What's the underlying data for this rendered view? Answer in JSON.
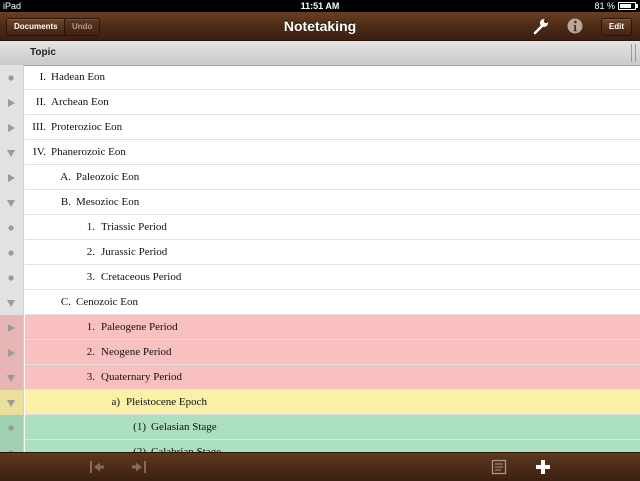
{
  "status_bar": {
    "device": "iPad",
    "time": "11:51 AM",
    "battery": "81 %",
    "battery_level": 0.81
  },
  "navbar": {
    "title": "Notetaking",
    "documents_label": "Documents",
    "undo_label": "Undo",
    "edit_label": "Edit",
    "icons": [
      "wrench-icon",
      "info-icon"
    ]
  },
  "column_header": {
    "label": "Topic"
  },
  "colors": {
    "navbar": "#4a2a15",
    "red_row": "#f9c0c0",
    "yellow_row": "#fbf0a8",
    "green_row": "#acdfbf"
  },
  "outline": [
    {
      "num": "I.",
      "text": "Hadean Eon",
      "level": 0,
      "state": "leaf",
      "color": "none"
    },
    {
      "num": "II.",
      "text": "Archean Eon",
      "level": 0,
      "state": "collapsed",
      "color": "none"
    },
    {
      "num": "III.",
      "text": "Proterozioc Eon",
      "level": 0,
      "state": "collapsed",
      "color": "none"
    },
    {
      "num": "IV.",
      "text": "Phanerozoic Eon",
      "level": 0,
      "state": "expanded",
      "color": "none"
    },
    {
      "num": "A.",
      "text": "Paleozoic Eon",
      "level": 1,
      "state": "collapsed",
      "color": "none"
    },
    {
      "num": "B.",
      "text": "Mesozioc Eon",
      "level": 1,
      "state": "expanded",
      "color": "none"
    },
    {
      "num": "1.",
      "text": "Triassic Period",
      "level": 2,
      "state": "leaf",
      "color": "none"
    },
    {
      "num": "2.",
      "text": "Jurassic Period",
      "level": 2,
      "state": "leaf",
      "color": "none"
    },
    {
      "num": "3.",
      "text": "Cretaceous Period",
      "level": 2,
      "state": "leaf",
      "color": "none"
    },
    {
      "num": "C.",
      "text": "Cenozoic Eon",
      "level": 1,
      "state": "expanded",
      "color": "none"
    },
    {
      "num": "1.",
      "text": "Paleogene Period",
      "level": 2,
      "state": "collapsed",
      "color": "red"
    },
    {
      "num": "2.",
      "text": "Neogene Period",
      "level": 2,
      "state": "collapsed",
      "color": "red"
    },
    {
      "num": "3.",
      "text": "Quaternary Period",
      "level": 2,
      "state": "expanded",
      "color": "red"
    },
    {
      "num": "a)",
      "text": "Pleistocene Epoch",
      "level": 3,
      "state": "expanded",
      "color": "yellow"
    },
    {
      "num": "(1)",
      "text": "Gelasian Stage",
      "level": 4,
      "state": "leaf",
      "color": "green"
    },
    {
      "num": "(2)",
      "text": "Calabrian Stage",
      "level": 4,
      "state": "leaf",
      "color": "green"
    }
  ],
  "toolbar": {
    "icons": [
      "outdent-icon",
      "indent-icon",
      "note-icon",
      "add-icon"
    ]
  }
}
